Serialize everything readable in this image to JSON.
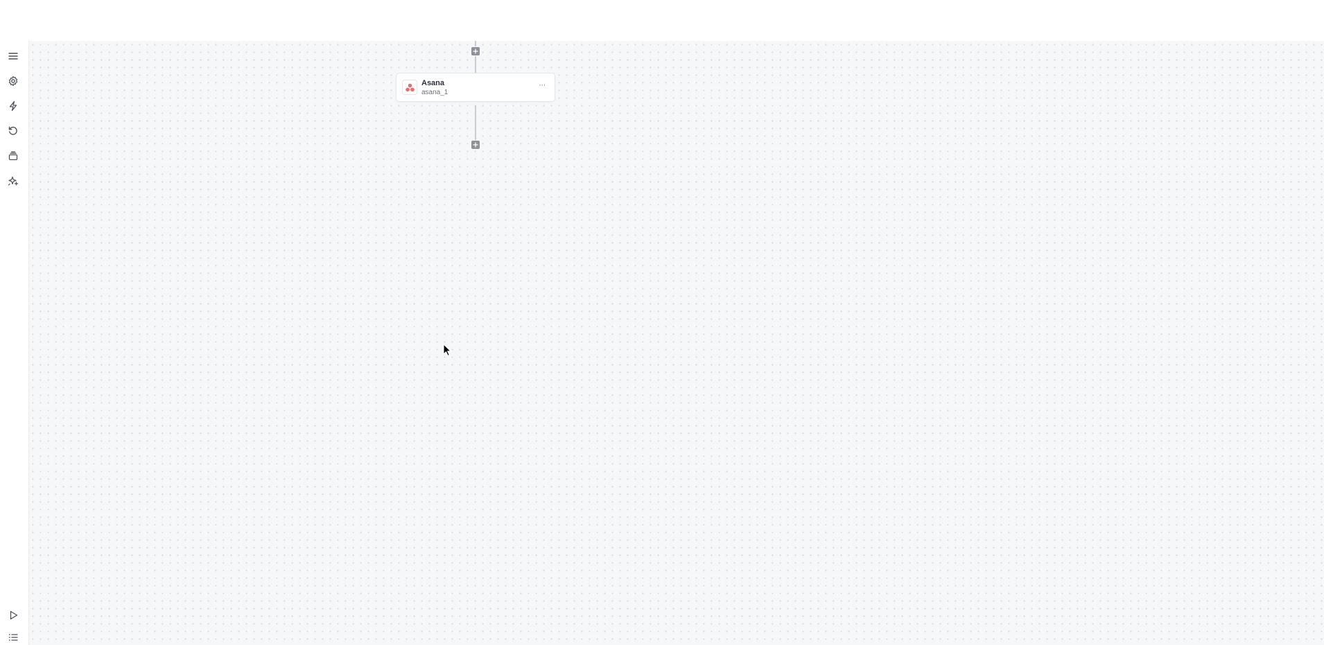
{
  "sidebar": {
    "items": [
      {
        "icon": "menu-icon"
      },
      {
        "icon": "gear-icon"
      },
      {
        "icon": "lightning-icon"
      },
      {
        "icon": "history-icon"
      },
      {
        "icon": "layers-icon"
      },
      {
        "icon": "sparkle-icon"
      }
    ],
    "bottom_items": [
      {
        "icon": "play-icon"
      },
      {
        "icon": "list-icon"
      }
    ]
  },
  "workflow": {
    "node": {
      "title": "Asana",
      "subtitle": "asana_1",
      "menu_label": "···",
      "logo_icon": "asana-logo-icon",
      "logo_color": "#f06a6a"
    }
  },
  "colors": {
    "canvas_bg": "#f5f7f9",
    "edge": "#c9ccd2",
    "add_button": "#8d9198"
  }
}
